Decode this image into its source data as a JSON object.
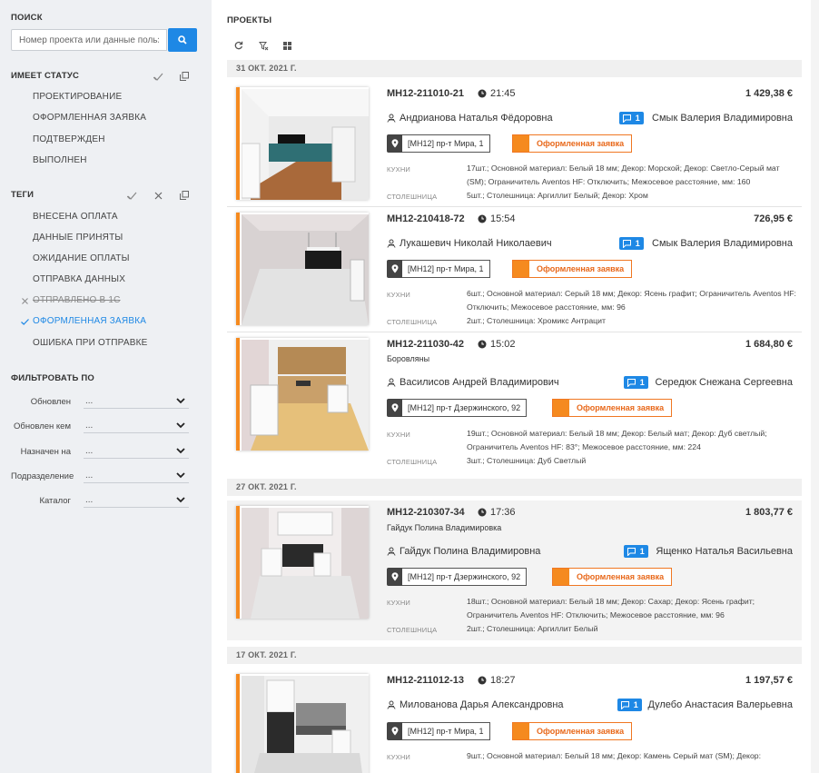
{
  "sidebar": {
    "search": {
      "title": "ПОИСК",
      "placeholder": "Номер проекта или данные пользователя"
    },
    "status_section": {
      "title": "ИМЕЕТ СТАТУС",
      "items": [
        "ПРОЕКТИРОВАНИЕ",
        "ОФОРМЛЕННАЯ ЗАЯВКА",
        "ПОДТВЕРЖДЕН",
        "ВЫПОЛНЕН"
      ]
    },
    "tags_section": {
      "title": "ТЕГИ",
      "items": [
        {
          "label": "ВНЕСЕНА ОПЛАТА",
          "state": "none"
        },
        {
          "label": "ДАННЫЕ ПРИНЯТЫ",
          "state": "none"
        },
        {
          "label": "ОЖИДАНИЕ ОПЛАТЫ",
          "state": "none"
        },
        {
          "label": "ОТПРАВКА ДАННЫХ",
          "state": "none"
        },
        {
          "label": "ОТПРАВЛЕНО В 1С",
          "state": "excluded"
        },
        {
          "label": "ОФОРМЛЕННАЯ ЗАЯВКА",
          "state": "included"
        },
        {
          "label": "ОШИБКА ПРИ ОТПРАВКЕ",
          "state": "none"
        }
      ]
    },
    "filter_section": {
      "title": "ФИЛЬТРОВАТЬ ПО",
      "filters": [
        {
          "label": "Обновлен",
          "value": "..."
        },
        {
          "label": "Обновлен кем",
          "value": "..."
        },
        {
          "label": "Назначен на",
          "value": "..."
        },
        {
          "label": "Подразделение",
          "value": "..."
        },
        {
          "label": "Каталог",
          "value": "..."
        }
      ]
    }
  },
  "main": {
    "title": "ПРОЕКТЫ",
    "date_groups": [
      "31 ОКТ. 2021 Г.",
      "27 ОКТ. 2021 Г.",
      "17 ОКТ. 2021 Г."
    ],
    "spec_labels": {
      "kitchen": "КУХНИ",
      "countertop": "СТОЛЕШНИЦА"
    },
    "projects": [
      {
        "number": "МН12-211010-21",
        "time": "21:45",
        "price": "1 429,38 €",
        "subtitle": "",
        "client": "Андрианова Наталья Фёдоровна",
        "messages": "1",
        "manager": "Смык Валерия Владимировна",
        "address": "[МН12] пр-т Мира, 1",
        "status": "Оформленная заявка",
        "kitchen": "17шт.; Основной материал: Белый 18 мм; Декор: Морской; Декор: Светло-Серый мат (SM); Ограничитель Aventos HF: Отключить; Межосевое расстояние, мм: 160",
        "countertop": "5шт.; Столешница: Аргиллит Белый; Декор: Хром"
      },
      {
        "number": "МН12-210418-72",
        "time": "15:54",
        "price": "726,95 €",
        "subtitle": "",
        "client": "Лукашевич Николай Николаевич",
        "messages": "1",
        "manager": "Смык Валерия Владимировна",
        "address": "[МН12] пр-т Мира, 1",
        "status": "Оформленная заявка",
        "kitchen": "6шт.; Основной материал: Серый 18 мм; Декор: Ясень графит; Ограничитель Aventos HF: Отключить; Межосевое расстояние, мм: 96",
        "countertop": "2шт.; Столешница: Хромикс Антрацит"
      },
      {
        "number": "МН12-211030-42",
        "time": "15:02",
        "price": "1 684,80 €",
        "subtitle": "Боровляны",
        "client": "Василисов Андрей Владимирович",
        "messages": "1",
        "manager": "Середюк Снежана Сергеевна",
        "address": "[МН12] пр-т Дзержинского, 92",
        "status": "Оформленная заявка",
        "kitchen": "19шт.; Основной материал: Белый 18 мм; Декор: Белый мат; Декор: Дуб светлый; Ограничитель Aventos HF: 83°; Межосевое расстояние, мм: 224",
        "countertop": "3шт.; Столешница: Дуб Светлый"
      },
      {
        "number": "МН12-210307-34",
        "time": "17:36",
        "price": "1 803,77 €",
        "subtitle": "Гайдук Полина Владимировка",
        "client": "Гайдук Полина Владимировна",
        "messages": "1",
        "manager": "Ященко Наталья Васильевна",
        "address": "[МН12] пр-т Дзержинского, 92",
        "status": "Оформленная заявка",
        "kitchen": "18шт.; Основной материал: Белый 18 мм; Декор: Сахар; Декор: Ясень графит; Ограничитель Aventos HF: Отключить; Межосевое расстояние, мм: 96",
        "countertop": "2шт.; Столешница: Аргиллит Белый"
      },
      {
        "number": "МН12-211012-13",
        "time": "18:27",
        "price": "1 197,57 €",
        "subtitle": "",
        "client": "Милованова Дарья Александровна",
        "messages": "1",
        "manager": "Дулебо Анастасия Валерьевна",
        "address": "[МН12] пр-т Мира, 1",
        "status": "Оформленная заявка",
        "kitchen": "9шт.; Основной материал: Белый 18 мм; Декор: Камень Серый мат (SM); Декор:",
        "countertop": ""
      }
    ]
  },
  "icons": {
    "search": "search-icon",
    "check": "check-icon",
    "copy": "copy-icon",
    "close": "close-icon",
    "refresh": "refresh-icon",
    "filter_off": "filter-off-icon",
    "grid": "grid-view-icon",
    "clock": "clock-icon",
    "user": "user-icon",
    "chat": "chat-icon",
    "pin": "map-pin-icon",
    "chevron": "chevron-down-icon"
  },
  "colors": {
    "accent": "#1e88e5",
    "status": "#f58a1f",
    "sidebar_bg": "#eef0f3"
  }
}
